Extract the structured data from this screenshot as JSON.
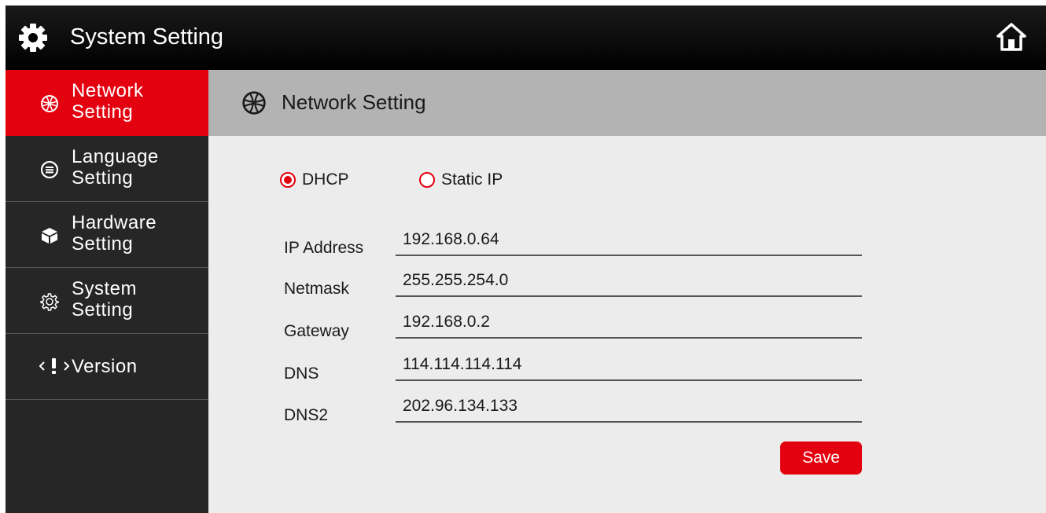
{
  "header": {
    "title": "System Setting",
    "icon": "gear-icon",
    "home_icon": "home-icon"
  },
  "sidebar": {
    "items": [
      {
        "line1": "Network",
        "line2": "Setting",
        "icon": "network-globe-icon",
        "active": true
      },
      {
        "line1": "Language",
        "line2": "Setting",
        "icon": "language-icon",
        "active": false
      },
      {
        "line1": "Hardware",
        "line2": "Setting",
        "icon": "hardware-box-icon",
        "active": false
      },
      {
        "line1": "System",
        "line2": "Setting",
        "icon": "settings-gear-icon",
        "active": false
      },
      {
        "label": "Version",
        "icon": "version-icon",
        "active": false
      }
    ]
  },
  "section": {
    "title": "Network Setting",
    "icon": "network-globe-icon"
  },
  "ip_mode": {
    "options": [
      {
        "label": "DHCP",
        "checked": true
      },
      {
        "label": "Static IP",
        "checked": false
      }
    ]
  },
  "fields": {
    "ip_address": {
      "label": "IP Address",
      "value": "192.168.0.64"
    },
    "netmask": {
      "label": "Netmask",
      "value": "255.255.254.0"
    },
    "gateway": {
      "label": "Gateway",
      "value": "192.168.0.2"
    },
    "dns": {
      "label": "DNS",
      "value": "114.114.114.114"
    },
    "dns2": {
      "label": "DNS2",
      "value": "202.96.134.133"
    }
  },
  "save_label": "Save",
  "colors": {
    "accent": "#e3000f",
    "header_bg": "#000000",
    "sidebar_bg": "#262626",
    "section_bg": "#b3b3b3",
    "content_bg": "#ececec"
  }
}
